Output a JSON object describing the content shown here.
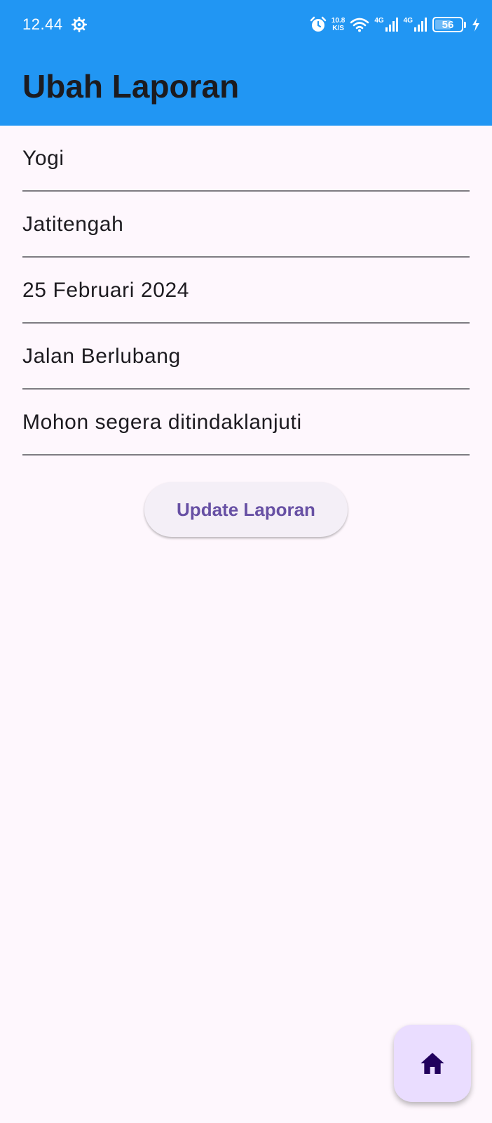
{
  "status_bar": {
    "time": "12.44",
    "net_speed_value": "10.8",
    "net_speed_unit": "K/S",
    "sim1_label": "4G",
    "sim2_label": "4G",
    "battery_percent": "56",
    "icons": [
      "settings-gear-icon",
      "alarm-icon",
      "wifi-icon",
      "signal-icon",
      "battery-icon",
      "charging-icon"
    ]
  },
  "app_bar": {
    "title": "Ubah Laporan",
    "color": "#2196f3"
  },
  "form": {
    "fields": [
      {
        "value": "Yogi"
      },
      {
        "value": "Jatitengah"
      },
      {
        "value": "25 Februari 2024"
      },
      {
        "value": "Jalan Berlubang"
      },
      {
        "value": "Mohon segera ditindaklanjuti"
      }
    ]
  },
  "update_button": {
    "label": "Update Laporan",
    "text_color": "#6750a4"
  },
  "fab": {
    "icon": "home-icon",
    "color": "#eaddff"
  }
}
